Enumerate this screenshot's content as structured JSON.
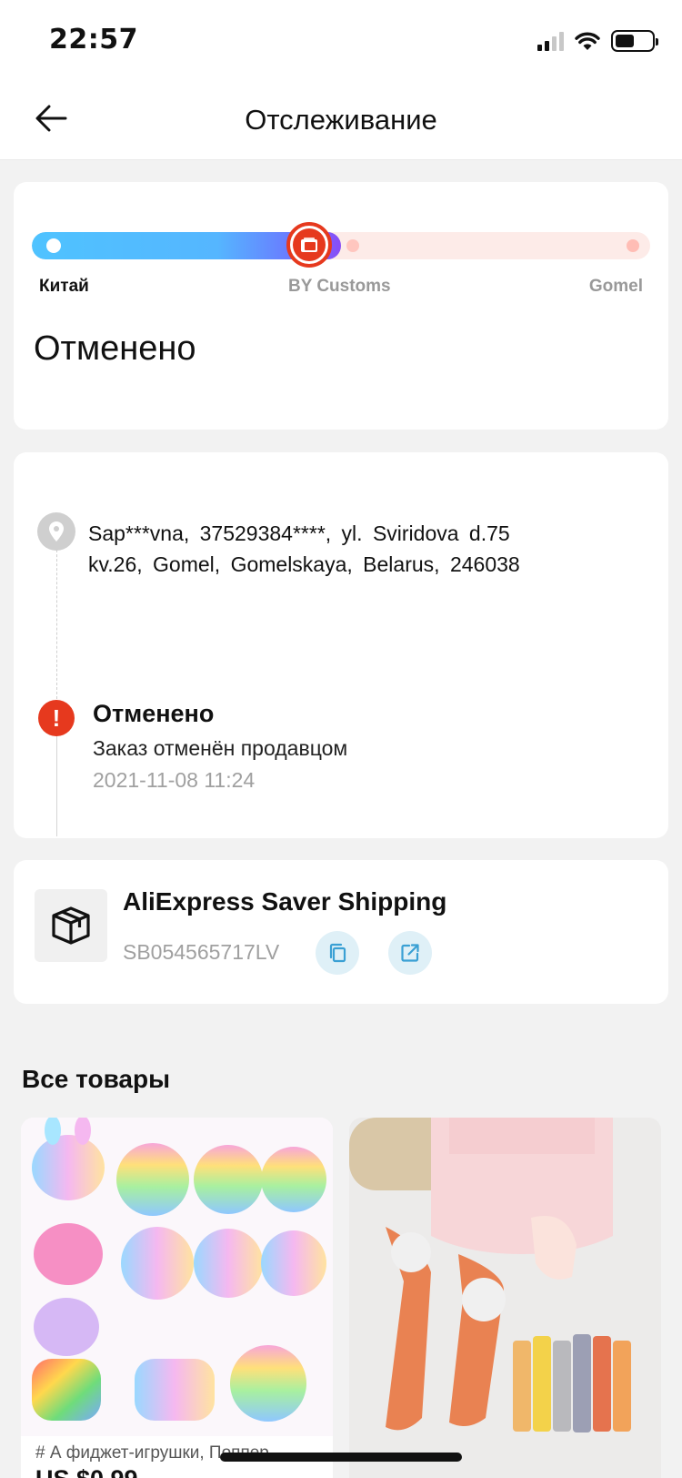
{
  "status_bar": {
    "time": "22:57"
  },
  "header": {
    "title": "Отслеживание"
  },
  "progress": {
    "stages": [
      "Китай",
      "BY Customs",
      "Gomel"
    ],
    "current_stage_index": 1,
    "status": "Отменено",
    "colors": {
      "accent": "#e6391e",
      "progress_start": "#4fc3ff",
      "progress_end": "#8a4cf5",
      "track": "#fdebe8"
    }
  },
  "tracking": {
    "address_line1": "Sap***vna, 37529384****, yl. Sviridova d.75",
    "address_line2": "kv.26, Gomel, Gomelskaya, Belarus, 246038",
    "event": {
      "title": "Отменено",
      "description": "Заказ отменён продавцом",
      "time": "2021-11-08 11:24"
    }
  },
  "shipping": {
    "carrier": "AliExpress Saver Shipping",
    "tracking_number": "SB054565717LV",
    "icons": [
      "box-icon",
      "copy-icon",
      "external-link-icon"
    ]
  },
  "products": {
    "section_title": "Все товары",
    "items": [
      {
        "caption": "# А фиджет-игрушки, Поппер...",
        "price": "US $0.99"
      },
      {
        "caption": "",
        "price": ""
      }
    ]
  }
}
